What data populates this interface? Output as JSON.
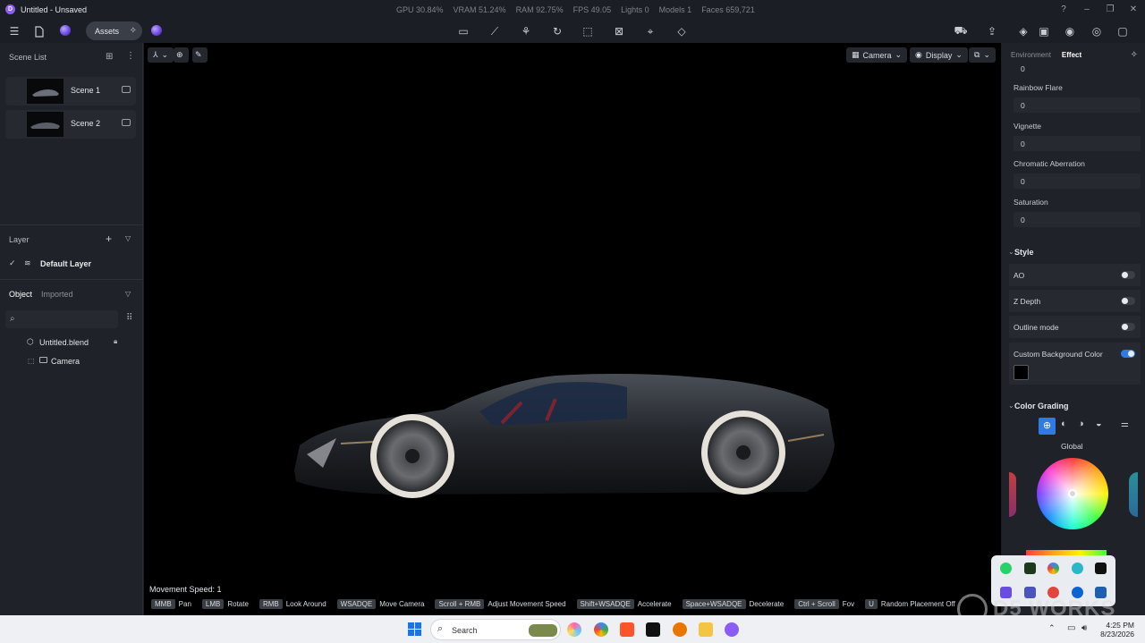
{
  "window": {
    "title": "Untitled - Unsaved",
    "stats": [
      "GPU 30.84%",
      "VRAM 51.24%",
      "RAM 92.75%",
      "FPS 49.05",
      "Lights 0",
      "Models 1",
      "Faces 659,721"
    ]
  },
  "toolbar": {
    "assets_label": "Assets"
  },
  "scene_list": {
    "title": "Scene List",
    "scenes": [
      {
        "label": "Scene 1"
      },
      {
        "label": "Scene 2"
      }
    ]
  },
  "layer": {
    "title": "Layer",
    "default_layer": "Default Layer"
  },
  "object": {
    "tabs": [
      "Object",
      "Imported"
    ],
    "items": [
      {
        "label": "Untitled.blend"
      },
      {
        "label": "Camera"
      }
    ]
  },
  "viewport": {
    "camera_label": "Camera",
    "display_label": "Display",
    "movement_speed": "Movement Speed: 1",
    "hints": [
      {
        "key": "MMB",
        "label": "Pan"
      },
      {
        "key": "LMB",
        "label": "Rotate"
      },
      {
        "key": "RMB",
        "label": "Look Around"
      },
      {
        "key": "WSADQE",
        "label": "Move Camera"
      },
      {
        "key": "Scroll + RMB",
        "label": "Adjust Movement Speed"
      },
      {
        "key": "Shift+WSADQE",
        "label": "Accelerate"
      },
      {
        "key": "Space+WSADQE",
        "label": "Decelerate"
      },
      {
        "key": "Ctrl + Scroll",
        "label": "Fov"
      },
      {
        "key": "U",
        "label": "Random Placement Off"
      }
    ]
  },
  "right_panel": {
    "tabs": [
      "Environment",
      "Effect"
    ],
    "top_value": "0",
    "fields": [
      {
        "label": "Rainbow Flare",
        "value": "0"
      },
      {
        "label": "Vignette",
        "value": "0"
      },
      {
        "label": "Chromatic Aberration",
        "value": "0"
      },
      {
        "label": "Saturation",
        "value": "0"
      }
    ],
    "style_title": "Style",
    "toggles": [
      {
        "label": "AO",
        "on": false
      },
      {
        "label": "Z Depth",
        "on": false
      },
      {
        "label": "Outline mode",
        "on": false
      },
      {
        "label": "Custom Background Color",
        "on": true
      }
    ],
    "background_color": "#000000",
    "color_grading_title": "Color Grading",
    "global_label": "Global"
  },
  "watermark": "D5 WORKS",
  "taskbar": {
    "search_placeholder": "Search",
    "time": "4:25 PM",
    "date": "8/23/2026"
  }
}
